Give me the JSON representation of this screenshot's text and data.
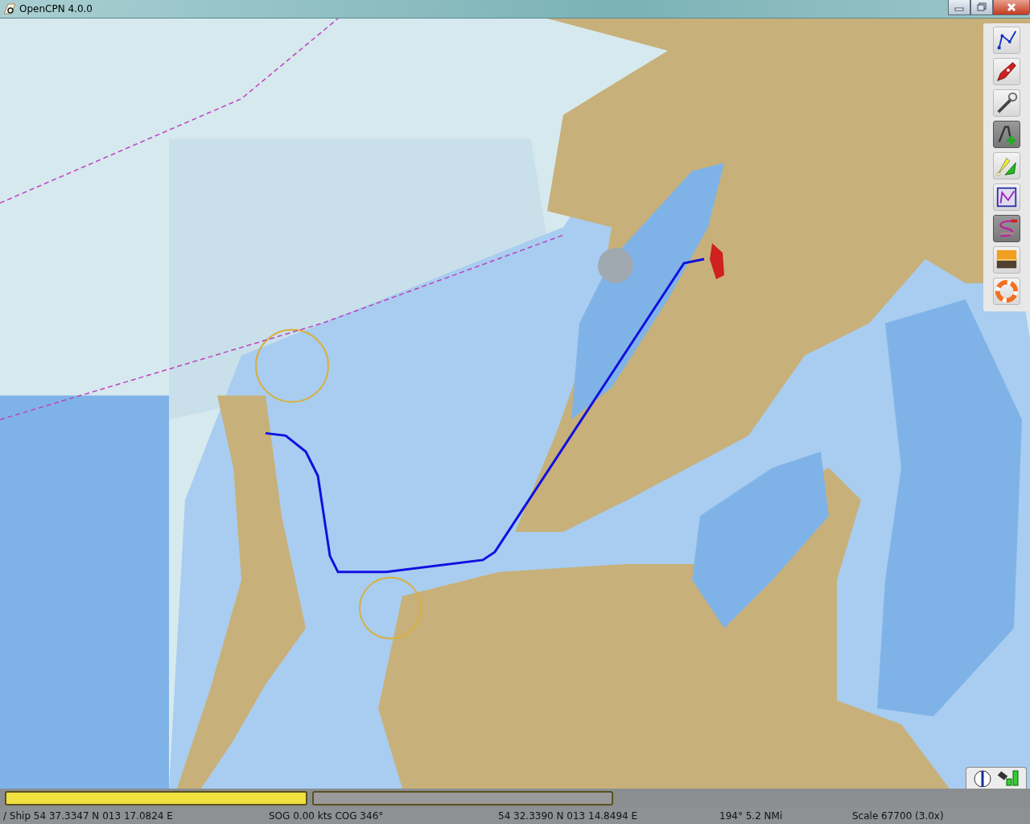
{
  "window": {
    "title": "OpenCPN 4.0.0"
  },
  "toolbar": [
    {
      "kind": "route",
      "on": false
    },
    {
      "kind": "ship",
      "on": false
    },
    {
      "kind": "tools",
      "on": false
    },
    {
      "kind": "text",
      "on": true
    },
    {
      "kind": "marks",
      "on": false
    },
    {
      "kind": "routes",
      "on": false
    },
    {
      "kind": "track",
      "on": true
    },
    {
      "kind": "sunset",
      "on": false
    },
    {
      "kind": "lifebuoy",
      "on": false
    }
  ],
  "chart_bar": [
    {
      "selected": true
    },
    {
      "selected": false
    }
  ],
  "status_bar": [
    "/ Ship 54 37.3347 N   013 17.0824 E",
    "SOG 0.00 kts  COG 346°",
    "54 32.3390 N   013 14.8494 E",
    "194°  5.2 NMi",
    "Scale 67700 (3.0x)"
  ]
}
